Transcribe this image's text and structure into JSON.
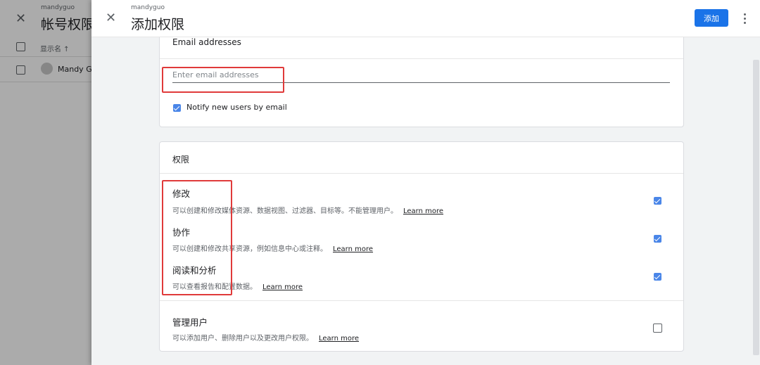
{
  "back_page": {
    "close_icon": "close-icon",
    "account_name": "mandyguo",
    "title": "帐号权限",
    "column_header": "显示名 ↑",
    "user_name": "Mandy Gu"
  },
  "dialog": {
    "close_icon": "close-icon",
    "account_name": "mandyguo",
    "title": "添加权限",
    "add_button": "添加",
    "more_icon": "more-vert-icon"
  },
  "email_card": {
    "title": "Email addresses",
    "input_placeholder": "Enter email addresses",
    "input_value": "",
    "notify_label": "Notify new users by email",
    "notify_checked": true
  },
  "permissions_card": {
    "title": "权限",
    "learn_more": "Learn more",
    "items": [
      {
        "title": "修改",
        "description": "可以创建和修改媒体资源、数据视图、过滤器、目标等。不能管理用户。",
        "checked": true
      },
      {
        "title": "协作",
        "description": "可以创建和修改共享资源，例如信息中心或注释。",
        "checked": true
      },
      {
        "title": "阅读和分析",
        "description": "可以查看报告和配置数据。",
        "checked": true
      },
      {
        "title": "管理用户",
        "description": "可以添加用户、删除用户以及更改用户权限。",
        "checked": false
      }
    ]
  },
  "colors": {
    "primary_button": "#1a73e8",
    "checkbox": "#4a86e8",
    "highlight_box": "#e03a3a"
  }
}
